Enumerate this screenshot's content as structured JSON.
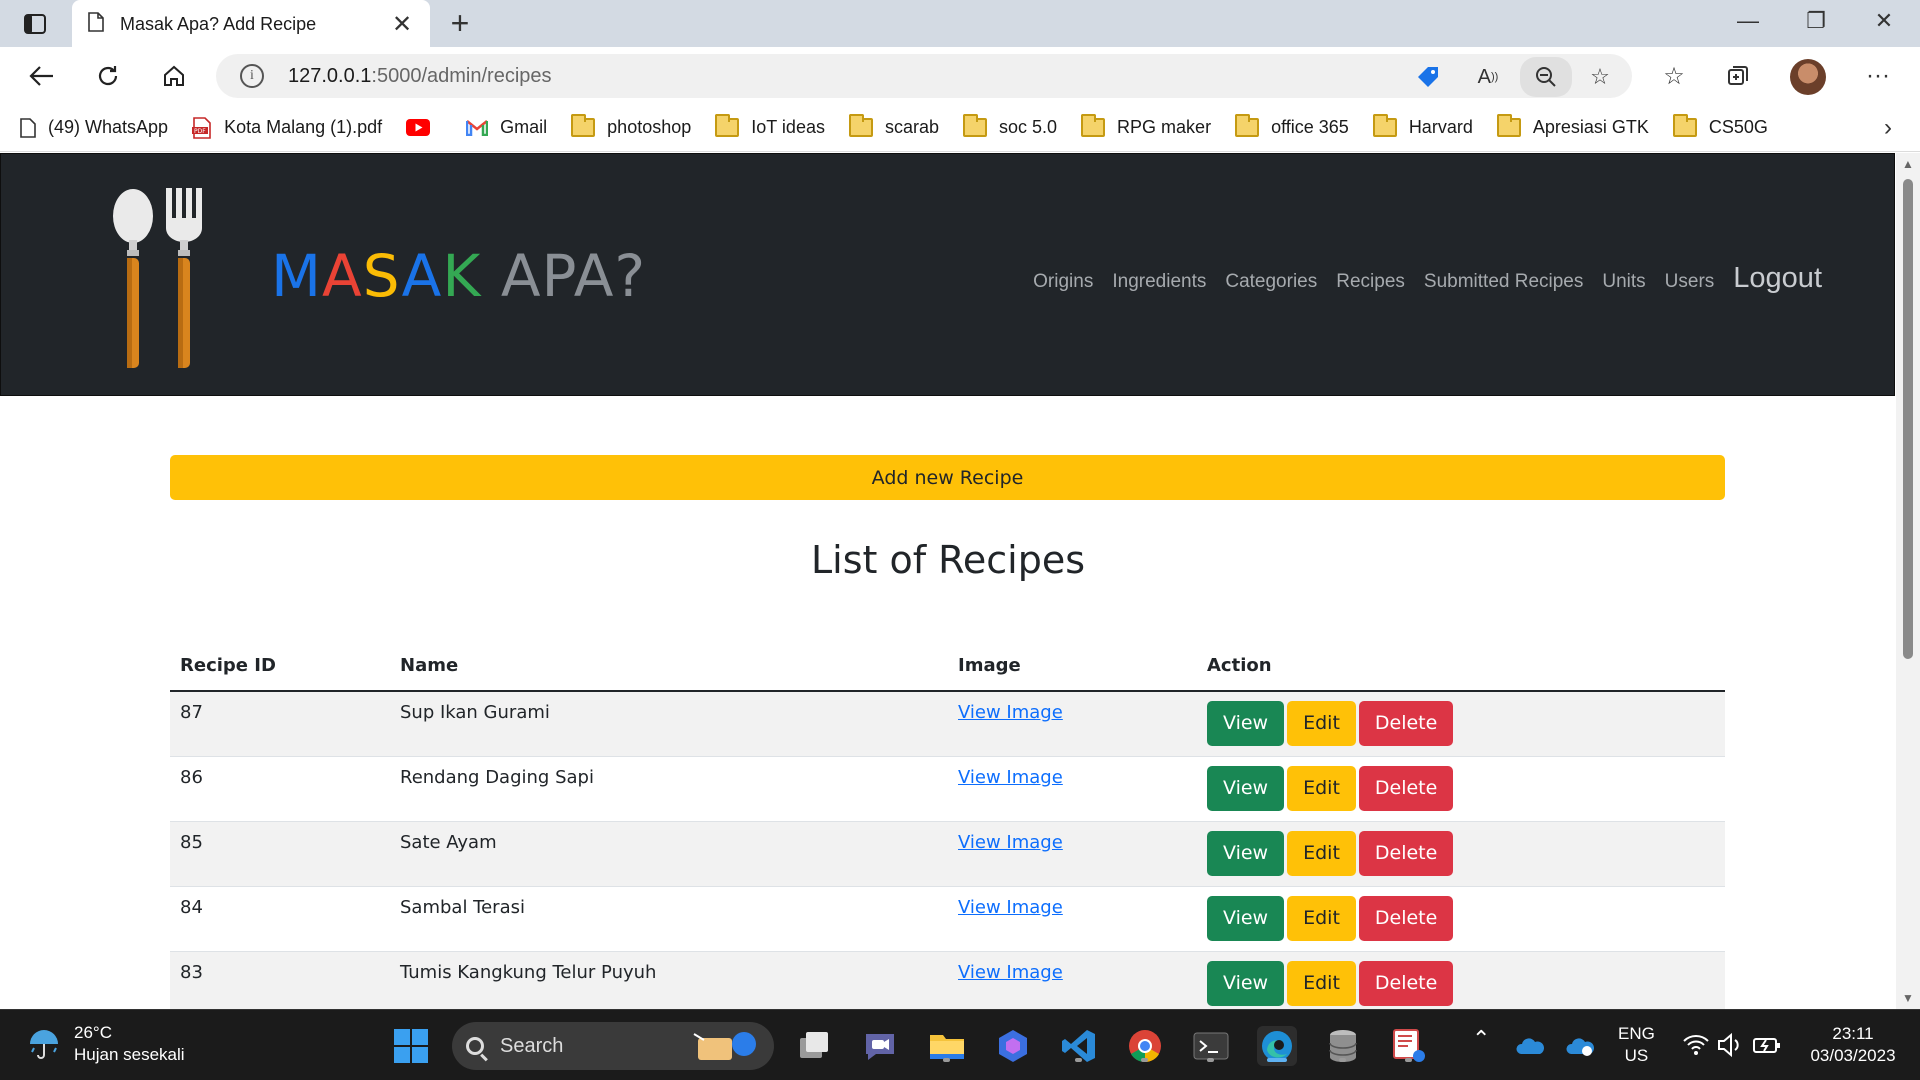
{
  "browser": {
    "tab_title": "Masak Apa? Add Recipe",
    "url_host": "127.0.0.1",
    "url_path": ":5000/admin/recipes",
    "bookmarks": [
      {
        "label": "(49) WhatsApp",
        "icon": "page-icon"
      },
      {
        "label": "Kota Malang (1).pdf",
        "icon": "pdf-icon"
      },
      {
        "label": "",
        "icon": "youtube-icon"
      },
      {
        "label": "Gmail",
        "icon": "gmail-icon"
      },
      {
        "label": "photoshop",
        "icon": "folder-icon"
      },
      {
        "label": "IoT ideas",
        "icon": "folder-icon"
      },
      {
        "label": "scarab",
        "icon": "folder-icon"
      },
      {
        "label": "soc 5.0",
        "icon": "folder-icon"
      },
      {
        "label": "RPG maker",
        "icon": "folder-icon"
      },
      {
        "label": "office 365",
        "icon": "folder-icon"
      },
      {
        "label": "Harvard",
        "icon": "folder-icon"
      },
      {
        "label": "Apresiasi GTK",
        "icon": "folder-icon"
      },
      {
        "label": "CS50G",
        "icon": "folder-icon"
      }
    ]
  },
  "site": {
    "brand_masak": "MASAK",
    "brand_apa": "APA?",
    "brand_colors": [
      "#1a73e8",
      "#ea4335",
      "#fbbc05",
      "#1a73e8",
      "#34a853",
      "#1a9bd7"
    ],
    "nav": {
      "origins": "Origins",
      "ingredients": "Ingredients",
      "categories": "Categories",
      "recipes": "Recipes",
      "submitted": "Submitted Recipes",
      "units": "Units",
      "users": "Users",
      "logout": "Logout"
    },
    "add_button": "Add new Recipe",
    "page_title": "List of Recipes",
    "table": {
      "headers": {
        "id": "Recipe ID",
        "name": "Name",
        "image": "Image",
        "action": "Action"
      },
      "view_image": "View Image",
      "btn_view": "View",
      "btn_edit": "Edit",
      "btn_delete": "Delete",
      "rows": [
        {
          "id": "87",
          "name": "Sup Ikan Gurami"
        },
        {
          "id": "86",
          "name": "Rendang Daging Sapi"
        },
        {
          "id": "85",
          "name": "Sate Ayam"
        },
        {
          "id": "84",
          "name": "Sambal Terasi"
        },
        {
          "id": "83",
          "name": "Tumis Kangkung Telur Puyuh"
        }
      ]
    }
  },
  "taskbar": {
    "temp": "26°C",
    "weather": "Hujan sesekali",
    "search": "Search",
    "lang": "ENG",
    "region": "US",
    "time": "23:11",
    "date": "03/03/2023"
  }
}
